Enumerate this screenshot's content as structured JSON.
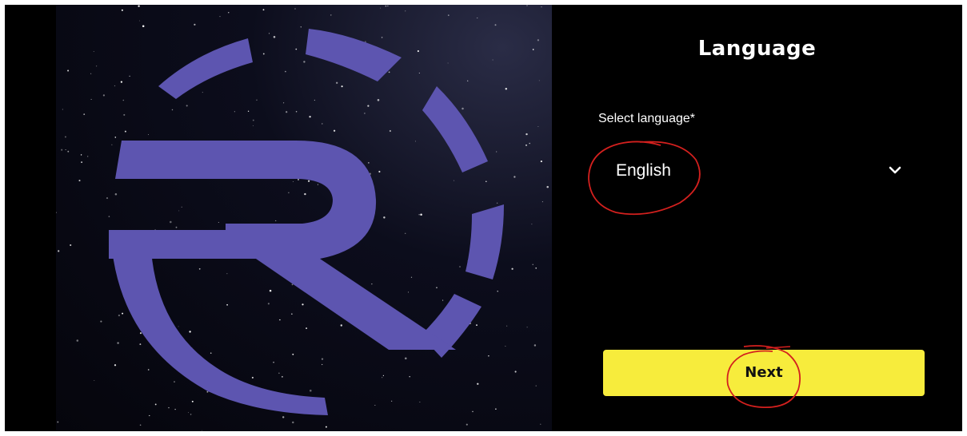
{
  "header": {
    "title": "Language"
  },
  "language_field": {
    "label": "Select language*",
    "selected": "English"
  },
  "actions": {
    "next_label": "Next"
  },
  "icons": {
    "dropdown": "chevron-down-icon",
    "logo": "r-logo"
  },
  "colors": {
    "background": "#000000",
    "accent_button": "#f7ec3c",
    "logo": "#5d55b0",
    "annotation": "#d3201e"
  }
}
